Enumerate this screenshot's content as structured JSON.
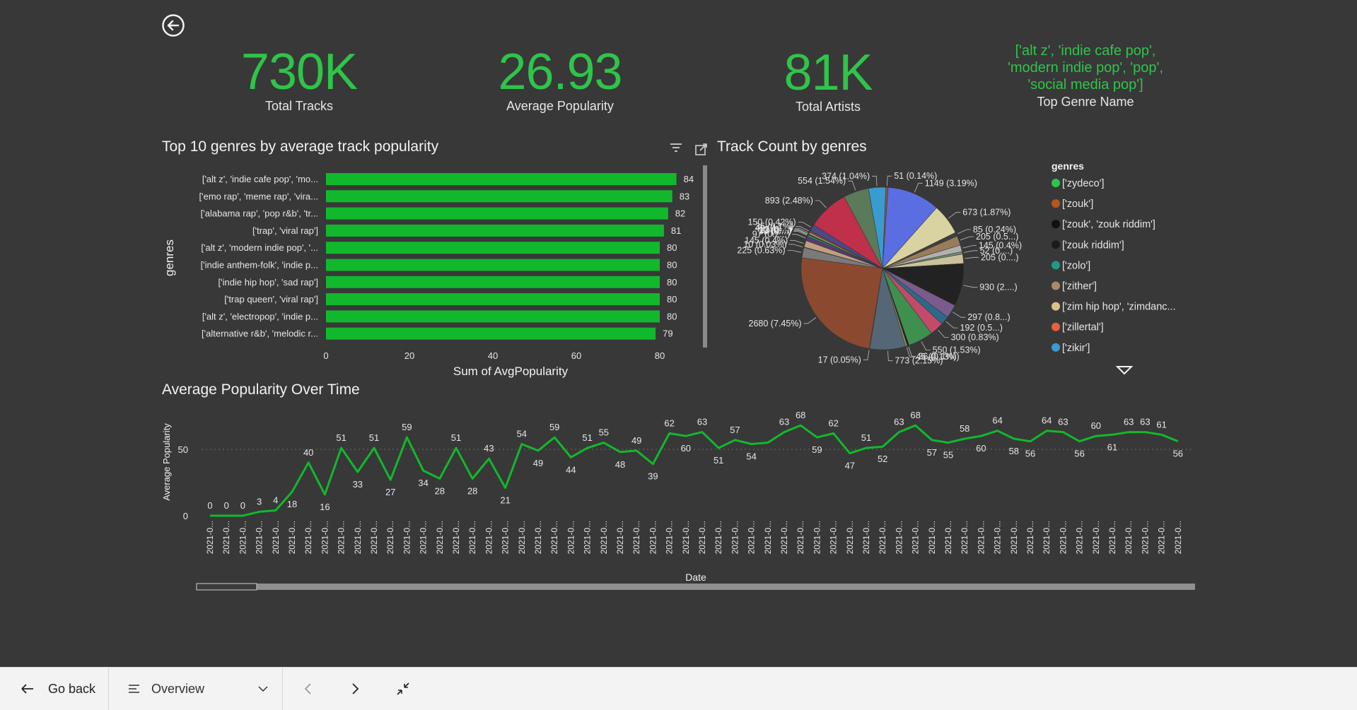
{
  "kpis": [
    {
      "value": "730K",
      "label": "Total Tracks"
    },
    {
      "value": "26.93",
      "label": "Average Popularity"
    },
    {
      "value": "81K",
      "label": "Total Artists"
    }
  ],
  "top_genre": {
    "value_lines": [
      "['alt z', 'indie cafe pop',",
      "'modern indie pop', 'pop',",
      "'social media pop']"
    ],
    "label": "Top Genre Name"
  },
  "bar_chart": {
    "title": "Top 10 genres by average track popularity",
    "xlabel": "Sum of AvgPopularity",
    "ylabel": "genres"
  },
  "pie_chart": {
    "title": "Track Count by genres",
    "legend_title": "genres",
    "legend_items": [
      {
        "label": "['zydeco']",
        "color": "#2fc44a"
      },
      {
        "label": "['zouk']",
        "color": "#b5561f"
      },
      {
        "label": "['zouk', 'zouk riddim']",
        "color": "#111111"
      },
      {
        "label": "['zouk riddim']",
        "color": "#1a1a1a"
      },
      {
        "label": "['zolo']",
        "color": "#1e9b87"
      },
      {
        "label": "['zither']",
        "color": "#a88a6b"
      },
      {
        "label": "['zim hip hop', 'zimdanc...",
        "color": "#d8c08d"
      },
      {
        "label": "['zillertal']",
        "color": "#e8603c"
      },
      {
        "label": "['zikir']",
        "color": "#3a9bd1"
      }
    ]
  },
  "line_chart": {
    "title": "Average Popularity Over Time",
    "ylabel": "Average Popularity",
    "xlabel": "Date",
    "tick_label": "2021-0..."
  },
  "footer": {
    "back_label": "Go back",
    "page_label": "Overview"
  },
  "colors": {
    "accent": "#2fc44a",
    "bar": "#12b82c",
    "background": "#383838"
  },
  "chart_data": [
    {
      "type": "bar",
      "orientation": "horizontal",
      "title": "Top 10 genres by average track popularity",
      "xlabel": "Sum of AvgPopularity",
      "ylabel": "genres",
      "categories": [
        "['alt z', 'indie cafe pop', 'mo...",
        "['emo rap', 'meme rap', 'vira...",
        "['alabama rap', 'pop r&b', 'tr...",
        "['trap', 'viral rap']",
        "['alt z', 'modern indie pop', '...",
        "['indie anthem-folk', 'indie p...",
        "['indie hip hop', 'sad rap']",
        "['trap queen', 'viral rap']",
        "['alt z', 'electropop', 'indie p...",
        "['alternative r&b', 'melodic r..."
      ],
      "values": [
        84,
        83,
        82,
        81,
        80,
        80,
        80,
        80,
        80,
        79
      ],
      "xlim": [
        0,
        84
      ],
      "xticks": [
        0,
        20,
        40,
        60,
        80
      ]
    },
    {
      "type": "pie",
      "title": "Track Count by genres",
      "labels": [
        "51 (0.14%)",
        "1149 (3.19%)",
        "673 (1.87%)",
        "85 (0.24%)",
        "205 (0.5...)",
        "145 (0.4%)",
        "52 (0....)",
        "205 (0....)",
        "930 (2....)",
        "297 (0.8...)",
        "192 (0.5...)",
        "300 (0.83%)",
        "550 (1.53%)",
        "36 (0.1%)",
        "45 (0.13%)",
        "773 (2.15%)",
        "17 (0.05%)",
        "2680 (7.45%)",
        "225 (0.63%)",
        "10 (0.03%)",
        "145 (0.4%)",
        "97 (0.2...)",
        "30 (0....)",
        "13 (0....)",
        "12 (0....)",
        "43 (0.1...)",
        "35 (0.1%)",
        "150 (0.42%)",
        "893 (2.48%)",
        "554 (1.54%)",
        "374 (1.04%)"
      ],
      "values": [
        51,
        1149,
        673,
        85,
        205,
        145,
        52,
        205,
        930,
        297,
        192,
        300,
        550,
        36,
        45,
        773,
        17,
        2680,
        225,
        10,
        145,
        97,
        30,
        13,
        12,
        43,
        35,
        150,
        893,
        554,
        374
      ]
    },
    {
      "type": "line",
      "title": "Average Popularity Over Time",
      "xlabel": "Date",
      "ylabel": "Average Popularity",
      "yticks": [
        0,
        50
      ],
      "values": [
        0,
        0,
        0,
        3,
        4,
        18,
        40,
        16,
        51,
        33,
        51,
        27,
        59,
        34,
        28,
        51,
        28,
        43,
        21,
        54,
        49,
        59,
        44,
        51,
        55,
        48,
        49,
        39,
        62,
        60,
        63,
        51,
        57,
        54,
        55,
        63,
        68,
        59,
        62,
        47,
        51,
        52,
        63,
        68,
        57,
        55,
        58,
        60,
        64,
        58,
        56,
        64,
        63,
        56,
        60,
        61,
        63,
        63,
        61,
        56
      ],
      "labels": [
        "0",
        "0",
        "0",
        "3",
        "4",
        "18",
        "40",
        "16",
        "51",
        "33",
        "51",
        "27",
        "59",
        "34",
        "28",
        "51",
        "28",
        "43",
        "21",
        "54",
        "49",
        "59",
        "44",
        "51",
        "55",
        "48",
        "49",
        "39",
        "62",
        "60",
        "63",
        "51",
        "57",
        "54",
        "",
        "63",
        "68",
        "59",
        "62",
        "47",
        "51",
        "52",
        "63",
        "68",
        "57",
        "55",
        "58",
        "60",
        "64",
        "58",
        "56",
        "64",
        "63",
        "56",
        "60",
        "61",
        "63",
        "63",
        "61",
        "56"
      ]
    }
  ]
}
